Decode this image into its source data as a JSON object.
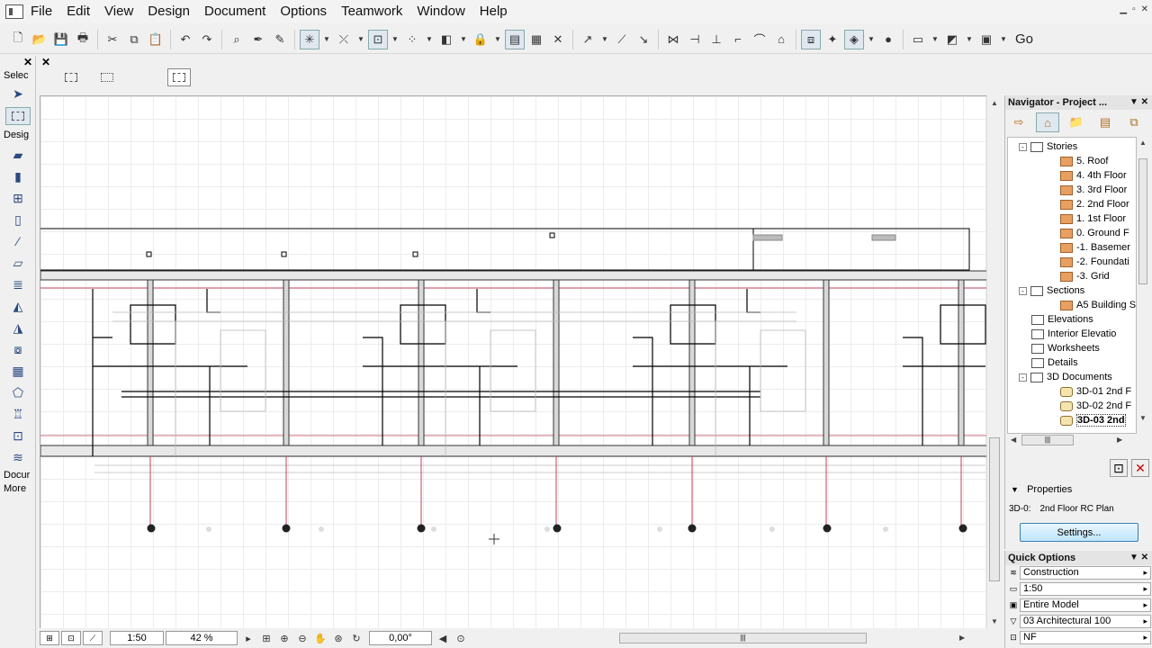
{
  "menubar": {
    "items": [
      "File",
      "Edit",
      "View",
      "Design",
      "Document",
      "Options",
      "Teamwork",
      "Window",
      "Help"
    ]
  },
  "toolbar": {
    "go_label": "Go"
  },
  "toolbox": {
    "select_label": "Selec",
    "design_label": "Desig",
    "document_label": "Docur",
    "more_label": "More"
  },
  "status": {
    "scale": "1:50",
    "zoom": "42 %",
    "angle": "0,00°"
  },
  "navigator": {
    "title": "Navigator - Project ...",
    "tree": [
      {
        "label": "Stories",
        "level": 0,
        "icon": "folder",
        "expander": "-"
      },
      {
        "label": "5. Roof",
        "level": 1,
        "icon": "story"
      },
      {
        "label": "4. 4th Floor",
        "level": 1,
        "icon": "story"
      },
      {
        "label": "3. 3rd Floor",
        "level": 1,
        "icon": "story"
      },
      {
        "label": "2. 2nd Floor",
        "level": 1,
        "icon": "story"
      },
      {
        "label": "1. 1st Floor",
        "level": 1,
        "icon": "story"
      },
      {
        "label": "0. Ground F",
        "level": 1,
        "icon": "story"
      },
      {
        "label": "-1. Basemer",
        "level": 1,
        "icon": "story"
      },
      {
        "label": "-2. Foundati",
        "level": 1,
        "icon": "story"
      },
      {
        "label": "-3. Grid",
        "level": 1,
        "icon": "story"
      },
      {
        "label": "Sections",
        "level": 0,
        "icon": "folder",
        "expander": "-"
      },
      {
        "label": "A5 Building S",
        "level": 1,
        "icon": "story"
      },
      {
        "label": "Elevations",
        "level": 0,
        "icon": "folder"
      },
      {
        "label": "Interior Elevatio",
        "level": 0,
        "icon": "folder"
      },
      {
        "label": "Worksheets",
        "level": 0,
        "icon": "folder"
      },
      {
        "label": "Details",
        "level": 0,
        "icon": "folder"
      },
      {
        "label": "3D Documents",
        "level": 0,
        "icon": "folder",
        "expander": "-"
      },
      {
        "label": "3D-01 2nd F",
        "level": 1,
        "icon": "doc3d"
      },
      {
        "label": "3D-02 2nd F",
        "level": 1,
        "icon": "doc3d"
      },
      {
        "label": "3D-03 2nd",
        "level": 1,
        "icon": "doc3d",
        "selected": true
      }
    ],
    "properties_label": "Properties",
    "prop_id": "3D-0:",
    "prop_name": "2nd Floor RC Plan",
    "settings_label": "Settings..."
  },
  "quick_options": {
    "title": "Quick Options",
    "rows": [
      "Construction",
      "1:50",
      "Entire Model",
      "03 Architectural 100",
      "NF"
    ]
  }
}
